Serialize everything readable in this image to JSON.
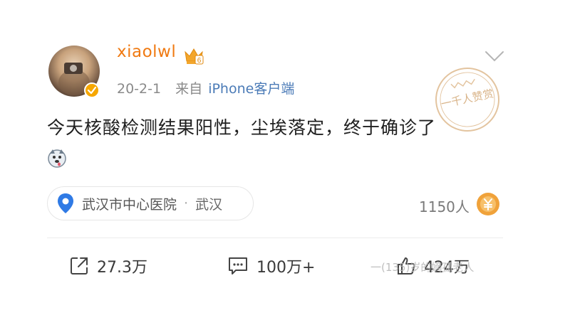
{
  "post": {
    "username": "xiaolwl",
    "member_level": "6",
    "date": "20-2-1",
    "from_label": "来自",
    "client": "iPhone客户端",
    "text": "今天核酸检测结果阳性，尘埃落定，终于确诊了",
    "emoji_icon": "husky-dog-face-icon",
    "stamp_text": "一千人赞赏",
    "location": {
      "place": "武汉市中心医院",
      "separator": "·",
      "city": "武汉"
    },
    "reward_count": "1150人",
    "actions": {
      "repost": "27.3万",
      "comment": "100万+",
      "like": "424万"
    },
    "watermark": "一(135)岁的嫡孤老人"
  },
  "colors": {
    "username": "#f07a12",
    "client_link": "#4b7bb7",
    "verified_badge": "#f6a700",
    "location_pin": "#2f7ae5",
    "reward": "#f0a23a"
  }
}
